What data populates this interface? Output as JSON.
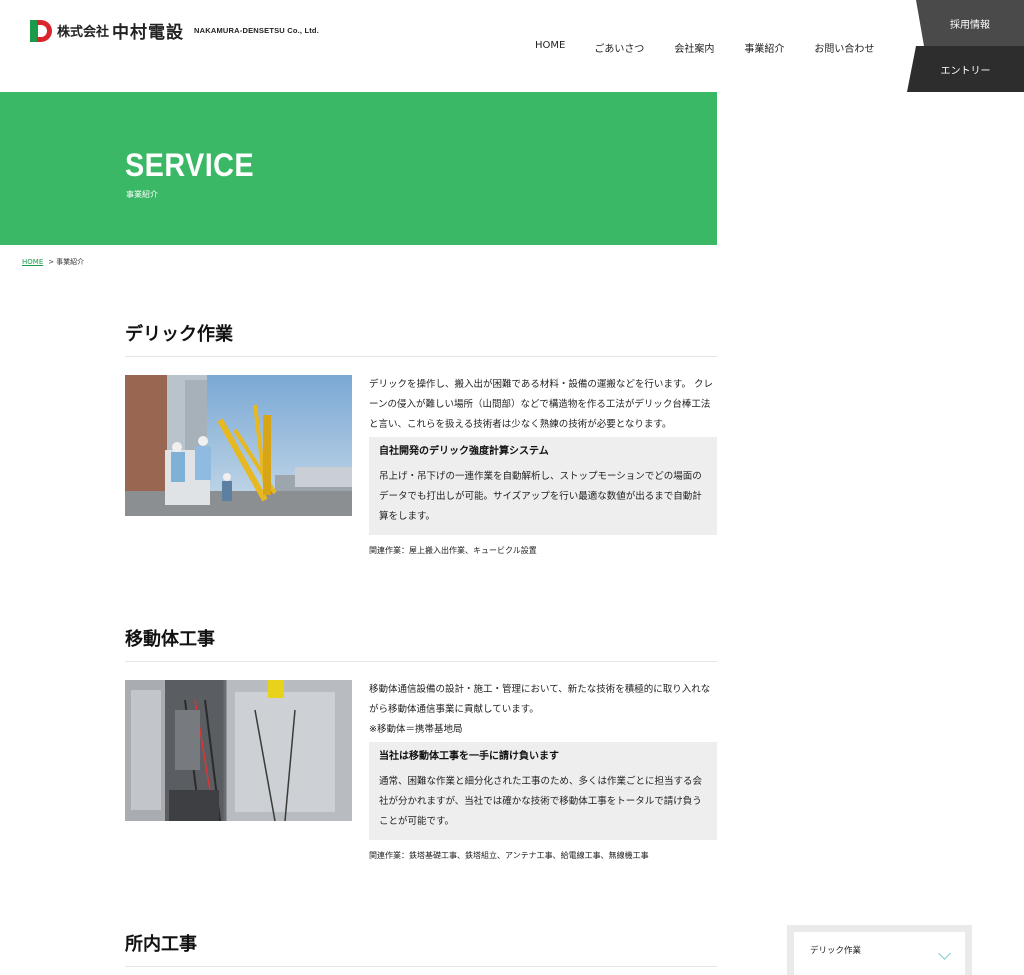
{
  "header": {
    "logo": {
      "company_prefix": "株式会社",
      "company_name": "中村電設",
      "english_name": "NAKAMURA-DENSETSU Co., Ltd.",
      "brand_colors": {
        "green": "#1b9a4a",
        "red": "#d8262e"
      }
    },
    "nav": [
      {
        "label": "HOME"
      },
      {
        "label": "ごあいさつ"
      },
      {
        "label": "会社案内"
      },
      {
        "label": "事業紹介"
      },
      {
        "label": "お問い合わせ"
      }
    ],
    "recruit_label": "採用情報",
    "entry_label": "エントリー"
  },
  "hero": {
    "title": "SERVICE",
    "subtitle": "事業紹介",
    "color": "#3ab865"
  },
  "breadcrumb": {
    "home": "HOME",
    "separator": ">",
    "current": "事業紹介"
  },
  "sections": [
    {
      "title": "デリック作業",
      "lead": "デリックを操作し、搬入出が困難である材料・設備の運搬などを行います。 クレーンの侵入が難しい場所（山間部）などで構造物を作る工法がデリック台棒工法と言い、これらを扱える技術者は少なく熟練の技術が必要となります。",
      "box_title": "自社開発のデリック強度計算システム",
      "box_text": "吊上げ・吊下げの一連作業を自動解析し、ストップモーションでどの場面のデータでも打出しが可能。サイズアップを行い最適な数値が出るまで自動計算をします。",
      "related": "関連作業：屋上搬入出作業、キュービクル設置",
      "image": "derrick-crane-photo"
    },
    {
      "title": "移動体工事",
      "lead": "移動体通信設備の設計・施工・管理において、新たな技術を積極的に取り入れながら移動体通信事業に貢献しています。",
      "note": "※移動体＝携帯基地局",
      "box_title": "当社は移動体工事を一手に請け負います",
      "box_text": "通常、困難な作業と細分化された工事のため、多くは作業ごとに担当する会社が分かれますが、当社では確かな技術で移動体工事をトータルで請け負うことが可能です。",
      "related": "関連作業：鉄塔基礎工事、鉄塔組立、アンテナ工事、給電線工事、無線機工事",
      "image": "mobile-equipment-photo"
    },
    {
      "title": "所内工事"
    }
  ],
  "side_menu": {
    "item_label": "デリック作業",
    "accent": "#7fcfd0"
  }
}
